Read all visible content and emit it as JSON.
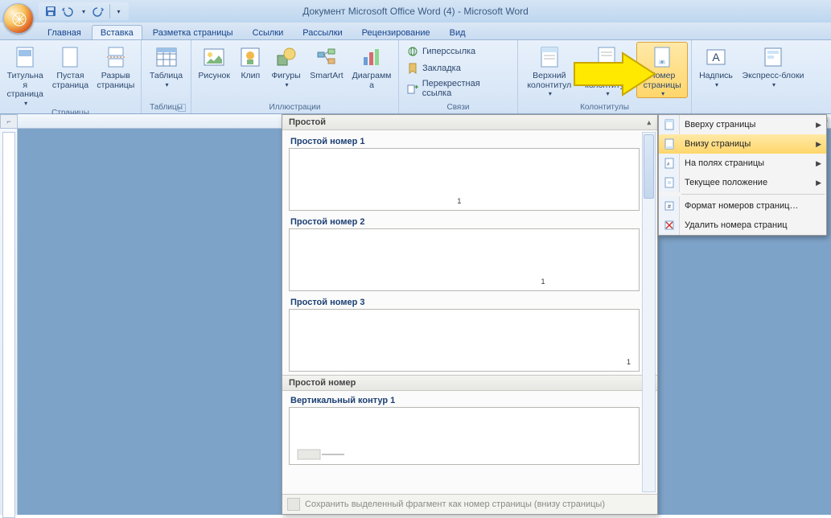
{
  "title": "Документ Microsoft Office Word (4) - Microsoft Word",
  "qat": {
    "save": "save-icon",
    "undo": "undo-icon",
    "redo": "redo-icon"
  },
  "tabs": [
    "Главная",
    "Вставка",
    "Разметка страницы",
    "Ссылки",
    "Рассылки",
    "Рецензирование",
    "Вид"
  ],
  "active_tab_index": 1,
  "ribbon": {
    "groups": [
      {
        "label": "Страницы",
        "items": [
          {
            "id": "cover-page",
            "label": "Титульная\nстраница",
            "drop": true
          },
          {
            "id": "blank-page",
            "label": "Пустая\nстраница",
            "drop": false
          },
          {
            "id": "page-break",
            "label": "Разрыв\nстраницы",
            "drop": false
          }
        ]
      },
      {
        "label": "Таблицы",
        "launcher": true,
        "items": [
          {
            "id": "table",
            "label": "Таблица",
            "drop": true
          }
        ]
      },
      {
        "label": "Иллюстрации",
        "items": [
          {
            "id": "picture",
            "label": "Рисунок",
            "drop": false
          },
          {
            "id": "clip",
            "label": "Клип",
            "drop": false
          },
          {
            "id": "shapes",
            "label": "Фигуры",
            "drop": true
          },
          {
            "id": "smartart",
            "label": "SmartArt",
            "drop": false
          },
          {
            "id": "chart",
            "label": "Диаграмма",
            "drop": false
          }
        ]
      },
      {
        "label": "Связи",
        "small": true,
        "items": [
          {
            "id": "hyperlink",
            "label": "Гиперссылка"
          },
          {
            "id": "bookmark",
            "label": "Закладка"
          },
          {
            "id": "crossref",
            "label": "Перекрестная ссылка"
          }
        ]
      },
      {
        "label": "Колонтитулы",
        "items": [
          {
            "id": "header",
            "label": "Верхний\nколонтитул",
            "drop": true
          },
          {
            "id": "footer",
            "label": "Нижний\nколонтитул",
            "drop": true
          },
          {
            "id": "page-number",
            "label": "Номер\nстраницы",
            "drop": true,
            "highlight": true
          }
        ]
      },
      {
        "label": "",
        "items": [
          {
            "id": "textbox",
            "label": "Надпись",
            "drop": true
          },
          {
            "id": "quick-parts",
            "label": "Экспресс-блоки",
            "drop": true
          }
        ]
      }
    ]
  },
  "page_number_menu": [
    {
      "id": "top",
      "label": "Вверху страницы",
      "sub": true
    },
    {
      "id": "bottom",
      "label": "Внизу страницы",
      "sub": true,
      "hl": true
    },
    {
      "id": "margins",
      "label": "На полях страницы",
      "sub": true
    },
    {
      "id": "current",
      "label": "Текущее положение",
      "sub": true
    },
    {
      "sep": true
    },
    {
      "id": "format",
      "label": "Формат номеров страниц…"
    },
    {
      "id": "remove",
      "label": "Удалить номера страниц"
    }
  ],
  "gallery": {
    "header": "Простой",
    "items": [
      {
        "label": "Простой номер 1",
        "pos": "left"
      },
      {
        "label": "Простой номер 2",
        "pos": "center"
      },
      {
        "label": "Простой номер 3",
        "pos": "right"
      }
    ],
    "section2": "Простой номер",
    "items2": [
      {
        "label": "Вертикальный контур 1",
        "pos": "left-shape"
      }
    ],
    "footer": "Сохранить выделенный фрагмент как номер страницы (внизу страницы)"
  },
  "ruler_corner": "⌐"
}
